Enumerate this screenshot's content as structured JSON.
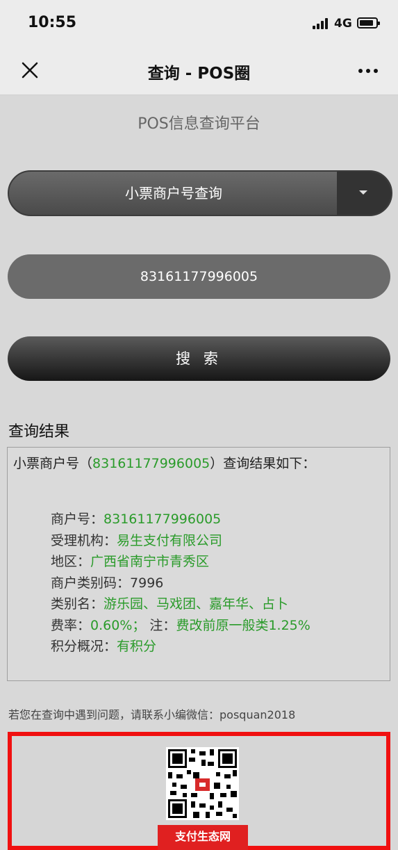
{
  "status_bar": {
    "time": "10:55",
    "network": "4G"
  },
  "nav": {
    "title": "查询 - POS圈"
  },
  "platform_title": "POS信息查询平台",
  "query": {
    "type_selected": "小票商户号查询",
    "merchant_input_value": "83161177996005",
    "search_label": "搜 索"
  },
  "result": {
    "heading": "查询结果",
    "intro_prefix": "小票商户号（",
    "intro_number": "83161177996005",
    "intro_suffix": "）查询结果如下：",
    "rows": [
      {
        "label": "商户号：",
        "value": "83161177996005"
      },
      {
        "label": "受理机构：",
        "value": "易生支付有限公司"
      },
      {
        "label": "地区：",
        "value": "广西省南宁市青秀区"
      },
      {
        "label": "商户类别码：",
        "value": "7996"
      },
      {
        "label": "类别名：",
        "value": "游乐园、马戏团、嘉年华、占卜"
      },
      {
        "label": "费率：",
        "value": "0.60%；",
        "note_label": "注：",
        "note_value": "费改前原一般类1.25%"
      },
      {
        "label": "积分概况：",
        "value": "有积分"
      }
    ]
  },
  "contact_note": "若您在查询中遇到问题，请联系小编微信：posquan2018",
  "promo": {
    "banner_text": "支付生态网"
  },
  "colors": {
    "accent_green": "#2a9b2a",
    "promo_border": "#f01010"
  },
  "icons": {
    "close": "close-icon",
    "more": "more-icon",
    "dropdown": "chevron-down-icon"
  }
}
